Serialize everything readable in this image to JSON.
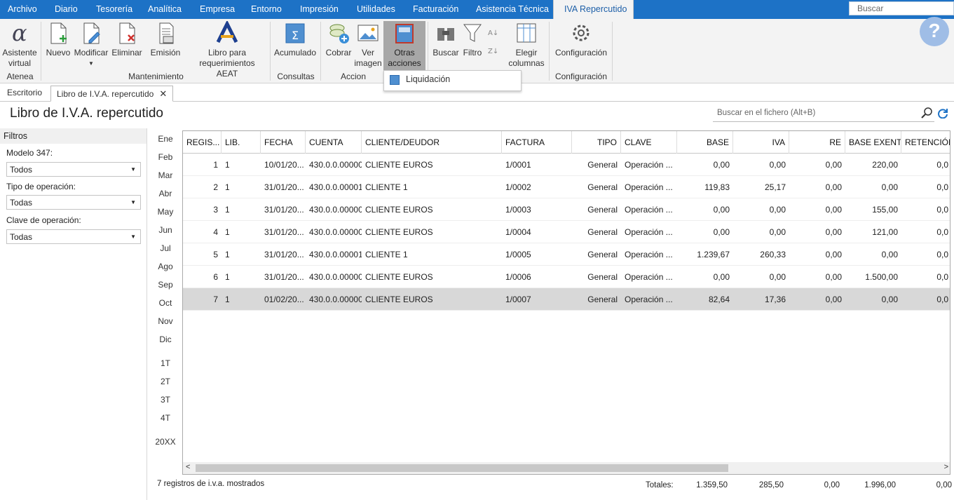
{
  "menu": [
    "Archivo",
    "Diario",
    "Tesorería",
    "Analítica",
    "Empresa",
    "Entorno",
    "Impresión",
    "Utilidades",
    "Facturación",
    "Asistencia Técnica",
    "IVA Repercutido"
  ],
  "search": {
    "placeholder": "Buscar"
  },
  "ribbon": {
    "atenea": {
      "btn1": "Asistente",
      "btn1b": "virtual",
      "label": "Atenea"
    },
    "mantenimiento": {
      "nuevo": "Nuevo",
      "modificar": "Modificar",
      "eliminar": "Eliminar",
      "emision": "Emisión",
      "libro1": "Libro para",
      "libro2": "requerimientos AEAT",
      "label": "Mantenimiento"
    },
    "consultas": {
      "acumulado": "Acumulado",
      "label": "Consultas"
    },
    "acciones": {
      "cobrar": "Cobrar",
      "ver1": "Ver",
      "ver2": "imagen",
      "otras1": "Otras",
      "otras2": "acciones",
      "buscar": "Buscar",
      "filtro": "Filtro",
      "elegir1": "Elegir",
      "elegir2": "columnas",
      "label": "Accion"
    },
    "configuracion": {
      "btn": "Configuración",
      "label": "Configuración"
    }
  },
  "dropdown": {
    "item": "Liquidación"
  },
  "tabs": {
    "t1": "Escritorio",
    "t2": "Libro de I.V.A. repercutido",
    "close": "✕"
  },
  "page": {
    "title": "Libro de I.V.A. repercutido",
    "search_placeholder": "Buscar en el fichero (Alt+B)"
  },
  "filters": {
    "title": "Filtros",
    "modelo_label": "Modelo 347:",
    "modelo_value": "Todos",
    "tipo_label": "Tipo de operación:",
    "tipo_value": "Todas",
    "clave_label": "Clave de operación:",
    "clave_value": "Todas"
  },
  "months": [
    "Ene",
    "Feb",
    "Mar",
    "Abr",
    "May",
    "Jun",
    "Jul",
    "Ago",
    "Sep",
    "Oct",
    "Nov",
    "Dic"
  ],
  "quarters": [
    "1T",
    "2T",
    "3T",
    "4T"
  ],
  "year": "20XX",
  "table": {
    "headers": [
      "REGIS...",
      "LIB.",
      "FECHA",
      "CUENTA",
      "CLIENTE/DEUDOR",
      "FACTURA",
      "TIPO",
      "CLAVE",
      "BASE",
      "IVA",
      "RE",
      "BASE EXENTA",
      "RETENCIÓN"
    ],
    "rows": [
      [
        "1",
        "1",
        "10/01/20...",
        "430.0.0.00000",
        "CLIENTE EUROS",
        "1/0001",
        "General",
        "Operación ...",
        "0,00",
        "0,00",
        "0,00",
        "220,00",
        "0,0"
      ],
      [
        "2",
        "1",
        "31/01/20...",
        "430.0.0.00001",
        "CLIENTE 1",
        "1/0002",
        "General",
        "Operación ...",
        "119,83",
        "25,17",
        "0,00",
        "0,00",
        "0,0"
      ],
      [
        "3",
        "1",
        "31/01/20...",
        "430.0.0.00000",
        "CLIENTE EUROS",
        "1/0003",
        "General",
        "Operación ...",
        "0,00",
        "0,00",
        "0,00",
        "155,00",
        "0,0"
      ],
      [
        "4",
        "1",
        "31/01/20...",
        "430.0.0.00000",
        "CLIENTE EUROS",
        "1/0004",
        "General",
        "Operación ...",
        "0,00",
        "0,00",
        "0,00",
        "121,00",
        "0,0"
      ],
      [
        "5",
        "1",
        "31/01/20...",
        "430.0.0.00001",
        "CLIENTE 1",
        "1/0005",
        "General",
        "Operación ...",
        "1.239,67",
        "260,33",
        "0,00",
        "0,00",
        "0,0"
      ],
      [
        "6",
        "1",
        "31/01/20...",
        "430.0.0.00000",
        "CLIENTE EUROS",
        "1/0006",
        "General",
        "Operación ...",
        "0,00",
        "0,00",
        "0,00",
        "1.500,00",
        "0,0"
      ],
      [
        "7",
        "1",
        "01/02/20...",
        "430.0.0.00000",
        "CLIENTE EUROS",
        "1/0007",
        "General",
        "Operación ...",
        "82,64",
        "17,36",
        "0,00",
        "0,00",
        "0,0"
      ]
    ]
  },
  "status": {
    "count": "7 registros de i.v.a. mostrados",
    "totals_label": "Totales:",
    "totals": [
      "1.359,50",
      "285,50",
      "0,00",
      "1.996,00",
      "0,00"
    ]
  },
  "help": {
    "symbol": "?"
  }
}
